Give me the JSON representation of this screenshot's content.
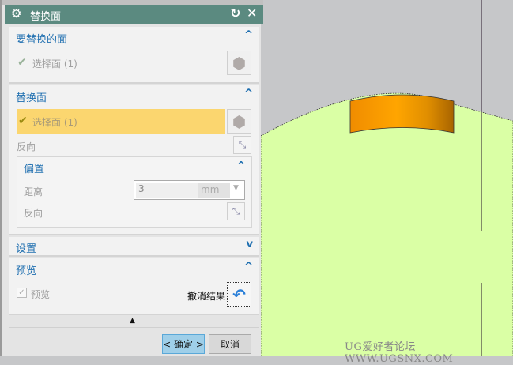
{
  "dialog": {
    "title": "替换面",
    "sections": {
      "faces_to_replace": {
        "title": "要替换的面",
        "select_label": "选择面 (1)"
      },
      "replacement_face": {
        "title": "替换面",
        "select_label": "选择面 (1)",
        "reverse_label": "反向",
        "offset": {
          "title": "偏置",
          "distance_label": "距离",
          "distance_value": "3",
          "unit": "mm",
          "reverse_label": "反向"
        }
      },
      "settings": {
        "title": "设置"
      },
      "preview": {
        "title": "预览",
        "preview_checkbox_label": "预览",
        "preview_checked": true,
        "undo_result_label": "撤消结果"
      }
    },
    "buttons": {
      "ok": "< 确定 >",
      "cancel": "取消"
    }
  },
  "viewport": {
    "watermark": "UG爱好者论坛 WWW.UGSNX.COM",
    "colors": {
      "background": "#c6c7c9",
      "body": "#daffa5",
      "selected_face": "#ffa500"
    }
  }
}
